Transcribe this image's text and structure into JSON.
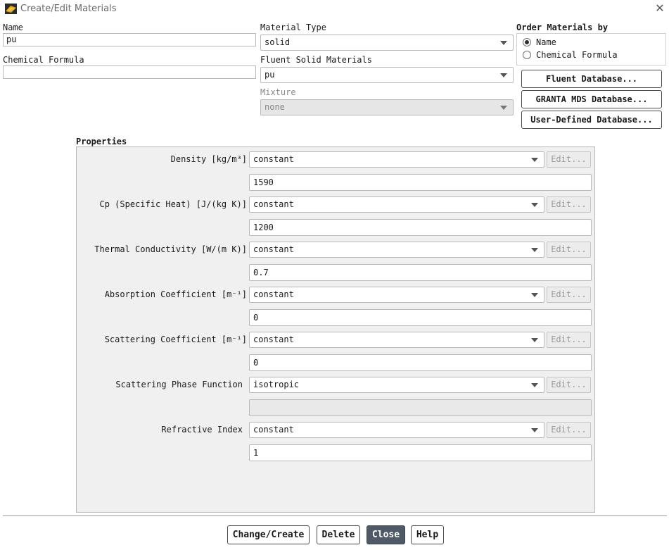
{
  "window": {
    "title": "Create/Edit Materials",
    "close_glyph": "✕"
  },
  "name": {
    "label": "Name",
    "value": "pu"
  },
  "chemical_formula": {
    "label": "Chemical Formula",
    "value": ""
  },
  "material_type": {
    "label": "Material Type",
    "value": "solid"
  },
  "fluent_solid_materials": {
    "label": "Fluent Solid Materials",
    "value": "pu"
  },
  "mixture": {
    "label": "Mixture",
    "value": "none"
  },
  "order_by": {
    "label": "Order Materials by",
    "options": [
      "Name",
      "Chemical Formula"
    ],
    "selected": "Name"
  },
  "databases": {
    "fluent": "Fluent Database...",
    "granta": "GRANTA MDS Database...",
    "user_defined": "User-Defined Database..."
  },
  "properties": {
    "label": "Properties",
    "edit_label": "Edit...",
    "items": [
      {
        "label": "Density [kg/m³]",
        "method": "constant",
        "value": "1590"
      },
      {
        "label": "Cp (Specific Heat) [J/(kg K)]",
        "method": "constant",
        "value": "1200"
      },
      {
        "label": "Thermal Conductivity [W/(m K)]",
        "method": "constant",
        "value": "0.7"
      },
      {
        "label": "Absorption Coefficient [m⁻¹]",
        "method": "constant",
        "value": "0"
      },
      {
        "label": "Scattering Coefficient [m⁻¹]",
        "method": "constant",
        "value": "0"
      },
      {
        "label": "Scattering Phase Function",
        "method": "isotropic",
        "value": ""
      },
      {
        "label": "Refractive Index",
        "method": "constant",
        "value": "1"
      }
    ]
  },
  "buttons": {
    "change_create": "Change/Create",
    "delete": "Delete",
    "close": "Close",
    "help": "Help"
  },
  "colors": {
    "primary_button": "#4f5a66",
    "panel_bg": "#f0f0f0"
  }
}
